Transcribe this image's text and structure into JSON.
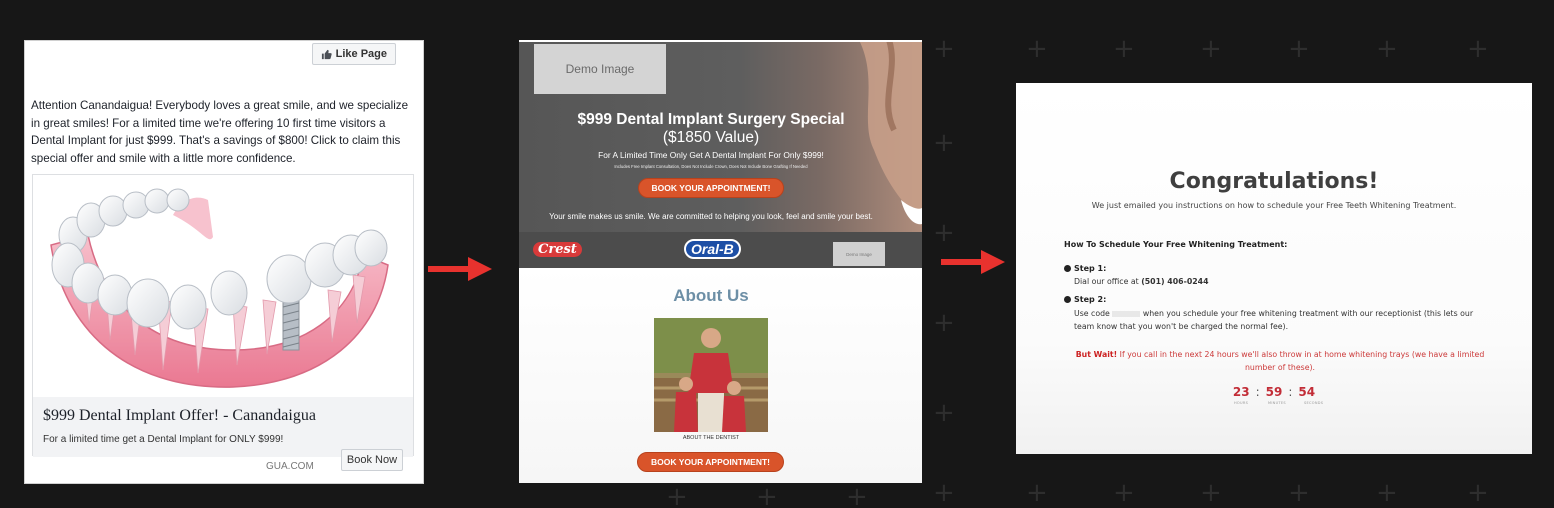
{
  "ad": {
    "like_button": "Like Page",
    "body_text": "Attention Canandaigua! Everybody loves a great smile, and we specialize in great smiles! For a limited time we're offering 10 first time visitors a Dental Implant for just $999. That's a savings of $800! Click to claim this special offer and smile with a little more confidence.",
    "headline": "$999 Dental Implant Offer! - Canandaigua",
    "description": "For a limited time get a Dental Implant for ONLY $999!",
    "domain": "GUA.COM",
    "cta_button": "Book Now"
  },
  "landing": {
    "demo_image": "Demo Image",
    "hero_title": "$999 Dental Implant Surgery Special",
    "hero_value": "($1850 Value)",
    "hero_subtitle": "For A Limited Time Only Get A Dental Implant For Only $999!",
    "hero_fine_print": "Includes Free Implant Consultation, Does Not Include Crown, Does Not Include Bone Grafting If Needed",
    "cta_button": "BOOK YOUR APPOINTMENT!",
    "tagline": "Your smile makes us smile. We are committed to helping you look, feel and smile your best.",
    "brand_crest": "Crest",
    "brand_oralb": "Oral-B",
    "demo_image_small": "Demo Image",
    "about_title": "About Us",
    "dentist_caption": "ABOUT THE DENTIST",
    "about_cta_button": "BOOK YOUR APPOINTMENT!"
  },
  "thanks": {
    "title": "Congratulations!",
    "subtitle": "We just emailed you instructions on how to schedule your Free Teeth Whitening Treatment.",
    "schedule_heading": "How To Schedule Your Free Whitening Treatment:",
    "step1_label": "Step 1:",
    "step1_text_prefix": "Dial our office at ",
    "step1_phone": "(501) 406-0244",
    "step2_label": "Step 2:",
    "step2_text_prefix": "Use code",
    "step2_text_rest": "when you schedule your free whitening treatment with our receptionist (this lets our team know that you won't be charged the normal fee).",
    "but_wait_bold": "But Wait!",
    "but_wait_text": " If you call in the next 24 hours we'll also throw in at home whitening trays (we have a limited number of these).",
    "countdown": {
      "hours": "23",
      "minutes": "59",
      "seconds": "54",
      "hours_label": "HOURS",
      "minutes_label": "MINUTES",
      "seconds_label": "SECONDS"
    }
  },
  "colors": {
    "background": "#171717",
    "cta_orange": "#d9542a",
    "arrow_red": "#e8322e",
    "about_title": "#6d8fa6",
    "countdown_red": "#c22d37"
  }
}
